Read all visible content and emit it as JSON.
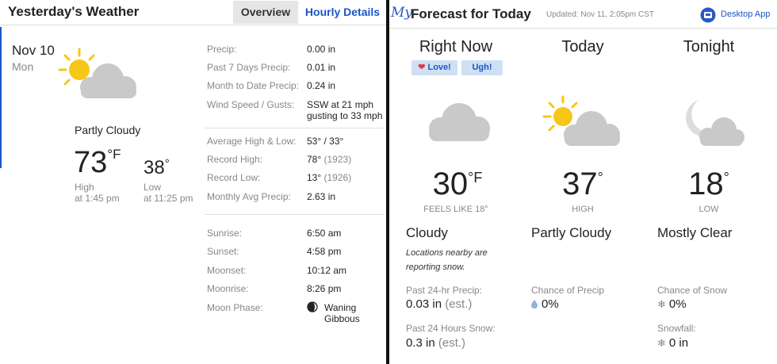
{
  "yesterday": {
    "title": "Yesterday's Weather",
    "tabs": {
      "overview": "Overview",
      "hourly": "Hourly Details"
    },
    "date": "Nov 10",
    "day": "Mon",
    "condition": "Partly Cloudy",
    "high": {
      "value": "73",
      "unit": "°F",
      "label": "High",
      "time": "at 1:45 pm"
    },
    "low": {
      "value": "38",
      "unit": "°",
      "label": "Low",
      "time": "at 11:25 pm"
    },
    "stats_group1": [
      {
        "label": "Precip:",
        "value": "0.00 in"
      },
      {
        "label": "Past 7 Days Precip:",
        "value": "0.01 in"
      },
      {
        "label": "Month to Date Precip:",
        "value": "0.24 in"
      },
      {
        "label": "Wind Speed / Gusts:",
        "value": "SSW at 21 mph",
        "value2": "gusting to 33 mph"
      }
    ],
    "stats_group2": [
      {
        "label": "Average High & Low:",
        "value": "53° / 33°"
      },
      {
        "label": "Record High:",
        "value": "78°",
        "extra": "(1923)"
      },
      {
        "label": "Record Low:",
        "value": "13°",
        "extra": "(1926)"
      },
      {
        "label": "Monthly Avg Precip:",
        "value": "2.63 in"
      }
    ],
    "stats_group3": [
      {
        "label": "Sunrise:",
        "value": "6:50 am"
      },
      {
        "label": "Sunset:",
        "value": "4:58 pm"
      },
      {
        "label": "Moonset:",
        "value": "10:12 am"
      },
      {
        "label": "Moonrise:",
        "value": "8:26 pm"
      },
      {
        "label": "Moon Phase:",
        "value": "Waning",
        "value2": "Gibbous"
      }
    ]
  },
  "forecast": {
    "logo": "My",
    "title": "Forecast for Today",
    "updated": "Updated: Nov 11, 2:05pm CST",
    "app_label": "Desktop App",
    "reactions": {
      "love": "Love!",
      "ugh": "Ugh!"
    },
    "columns": [
      {
        "heading": "Right Now",
        "temp": "30",
        "unit": "°F",
        "temp_label": "FEELS LIKE 18°",
        "condition": "Cloudy",
        "note": "Locations nearby are reporting snow.",
        "stat1_label": "Past 24-hr Precip:",
        "stat1_value": "0.03 in",
        "stat1_est": "(est.)",
        "stat2_label": "Past 24 Hours Snow:",
        "stat2_value": "0.3 in",
        "stat2_est": "(est.)"
      },
      {
        "heading": "Today",
        "temp": "37",
        "unit": "°",
        "temp_label": "HIGH",
        "condition": "Partly Cloudy",
        "stat1_label": "Chance of Precip",
        "stat1_value": "0%"
      },
      {
        "heading": "Tonight",
        "temp": "18",
        "unit": "°",
        "temp_label": "LOW",
        "condition": "Mostly Clear",
        "stat1_label": "Chance of Snow",
        "stat1_value": "0%",
        "stat2_label": "Snowfall:",
        "stat2_value": "0 in"
      }
    ]
  },
  "colors": {
    "accent": "#1a56c8",
    "sun": "#f6c718",
    "cloud": "#c9c9c9",
    "divider": "#111111"
  }
}
